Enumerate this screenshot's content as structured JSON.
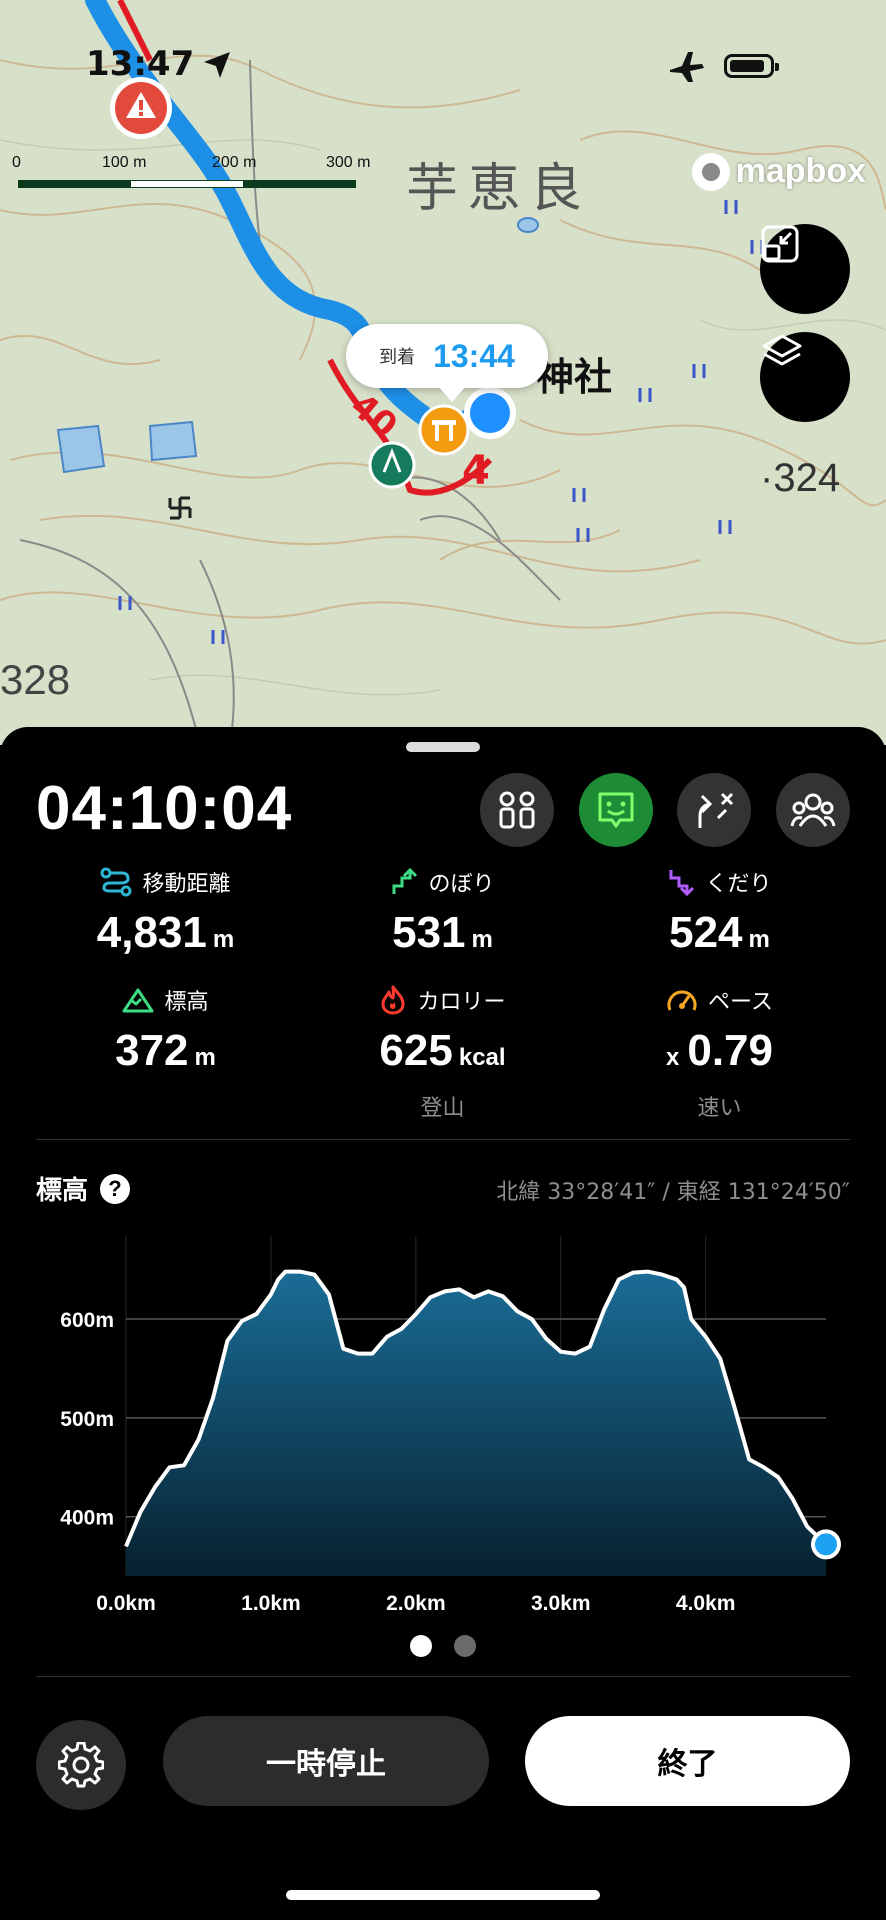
{
  "status_bar": {
    "time": "13:47"
  },
  "map": {
    "scale_ticks": [
      "0",
      "100 m",
      "200 m",
      "300 m"
    ],
    "place_name": "芋恵良",
    "shrine_label": "神社",
    "elev_324": "·324",
    "elev_328": "328",
    "route_num_a": "40",
    "route_num_b": "4",
    "mapbox": "mapbox",
    "arrival": {
      "label": "到着",
      "time": "13:44"
    },
    "colors": {
      "route": "#1d8fe6",
      "route_red": "#e01b24"
    }
  },
  "panel": {
    "elapsed": "04:10:04",
    "stats": [
      {
        "icon": "route-icon",
        "label": "移動距離",
        "value": "4,831",
        "unit": "m",
        "sub": ""
      },
      {
        "icon": "ascent-icon",
        "label": "のぼり",
        "value": "531",
        "unit": "m",
        "sub": ""
      },
      {
        "icon": "descent-icon",
        "label": "くだり",
        "value": "524",
        "unit": "m",
        "sub": ""
      },
      {
        "icon": "mountain-icon",
        "label": "標高",
        "value": "372",
        "unit": "m",
        "sub": ""
      },
      {
        "icon": "flame-icon",
        "label": "カロリー",
        "value": "625",
        "unit": "kcal",
        "sub": "登山"
      },
      {
        "icon": "speedometer-icon",
        "label": "ペース",
        "prefix": "x",
        "value": "0.79",
        "unit": "",
        "sub": "速い"
      }
    ],
    "elevation_title": "標高",
    "help": "?",
    "coords": "北緯 33°28′41″ / 東経 131°24′50″",
    "buttons": {
      "pause": "一時停止",
      "end": "終了"
    }
  },
  "chart_data": {
    "type": "area",
    "title": "標高",
    "xlabel": "",
    "ylabel": "",
    "x_ticks": [
      "0.0km",
      "1.0km",
      "2.0km",
      "3.0km",
      "4.0km"
    ],
    "y_ticks": [
      "400m",
      "500m",
      "600m"
    ],
    "xlim": [
      0,
      4.83
    ],
    "ylim": [
      340,
      680
    ],
    "grid": true,
    "series": [
      {
        "x": [
          0,
          0.1,
          0.2,
          0.3,
          0.4,
          0.5,
          0.6,
          0.7,
          0.8,
          0.9,
          1.0,
          1.05,
          1.1,
          1.2,
          1.3,
          1.4,
          1.5,
          1.6,
          1.7,
          1.8,
          1.9,
          2.0,
          2.1,
          2.2,
          2.3,
          2.4,
          2.5,
          2.6,
          2.7,
          2.8,
          2.9,
          3.0,
          3.1,
          3.2,
          3.3,
          3.4,
          3.5,
          3.6,
          3.7,
          3.8,
          3.85,
          3.9,
          4.0,
          4.1,
          4.2,
          4.3,
          4.4,
          4.5,
          4.6,
          4.7,
          4.83
        ],
        "y": [
          370,
          405,
          430,
          450,
          452,
          478,
          520,
          578,
          598,
          605,
          625,
          640,
          648,
          648,
          645,
          625,
          570,
          565,
          565,
          582,
          590,
          605,
          622,
          628,
          630,
          622,
          628,
          623,
          608,
          600,
          580,
          567,
          565,
          572,
          610,
          640,
          647,
          648,
          645,
          640,
          632,
          600,
          582,
          560,
          510,
          458,
          450,
          440,
          418,
          390,
          372
        ]
      }
    ],
    "current_point": {
      "x": 4.83,
      "y": 372
    },
    "pager": {
      "count": 2,
      "active": 0
    },
    "colors": {
      "line": "#ffffff",
      "fill_top": "#1a6d97",
      "fill_bottom": "#07212f",
      "marker": "#1da1f2",
      "grid": "#555555"
    }
  }
}
